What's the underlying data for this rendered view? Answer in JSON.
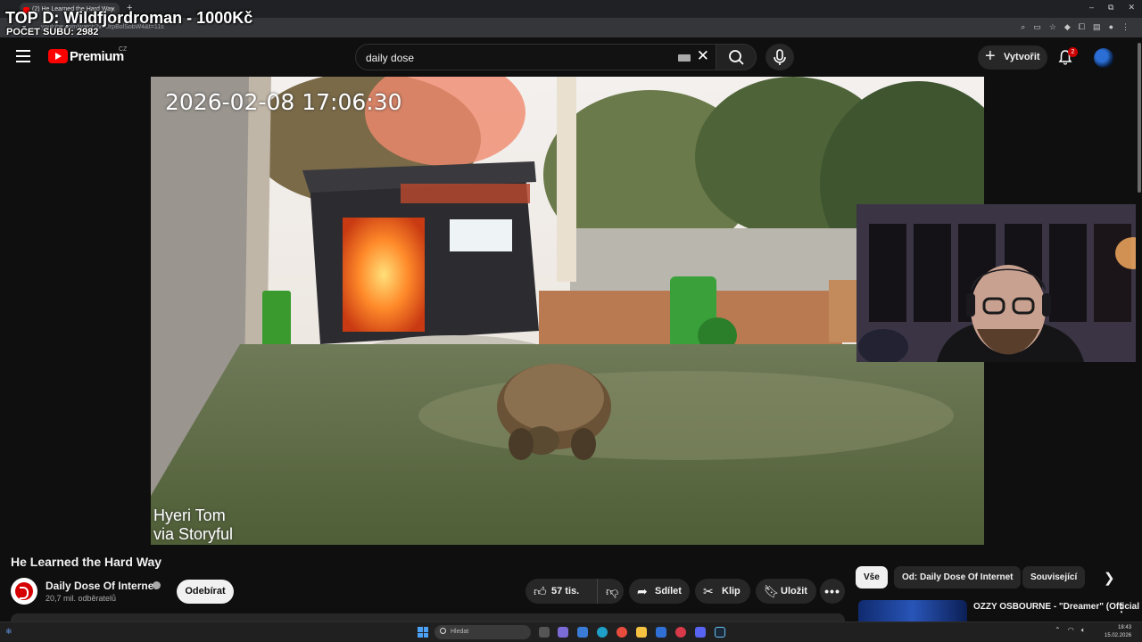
{
  "browser": {
    "tab_title": "(2) He Learned the Hard Way",
    "url": "youtube.com/watch?v=UrpBolSobW4&t=11s",
    "new_tab": "+",
    "tab_close": "×"
  },
  "stream_overlay": {
    "title": "TOP D: Wildfjordroman - 1000Kč",
    "subs": "POČET SUBŮ: 2982"
  },
  "yt_header": {
    "logo_text": "Premium",
    "country": "CZ",
    "search_value": "daily dose",
    "create_label": "Vytvořit",
    "notification_count": "2"
  },
  "player": {
    "timestamp": "2026-02-08 17:06:30",
    "credit_line1": "Hyeri Tom",
    "credit_line2": "via Storyful"
  },
  "video": {
    "title": "He Learned the Hard Way",
    "channel_name": "Daily Dose Of Internet",
    "subscribers": "20,7 mil. odběratelů",
    "subscribe_label": "Odebírat",
    "likes": "57 tis.",
    "share_label": "Sdílet",
    "clip_label": "Klip",
    "save_label": "Uložit",
    "more_label": "•••"
  },
  "sidebar": {
    "chips": [
      "Vše",
      "Od: Daily Dose Of Internet",
      "Související"
    ],
    "recommendation_title": "OZZY OSBOURNE - \"Dreamer\" (Official Video)"
  },
  "taskbar": {
    "search_placeholder": "Hledat",
    "time": "18:43",
    "date": "15.02.2026"
  },
  "colors": {
    "accent": "#ff0000",
    "background": "#0f0f0f",
    "surface": "#272727"
  }
}
